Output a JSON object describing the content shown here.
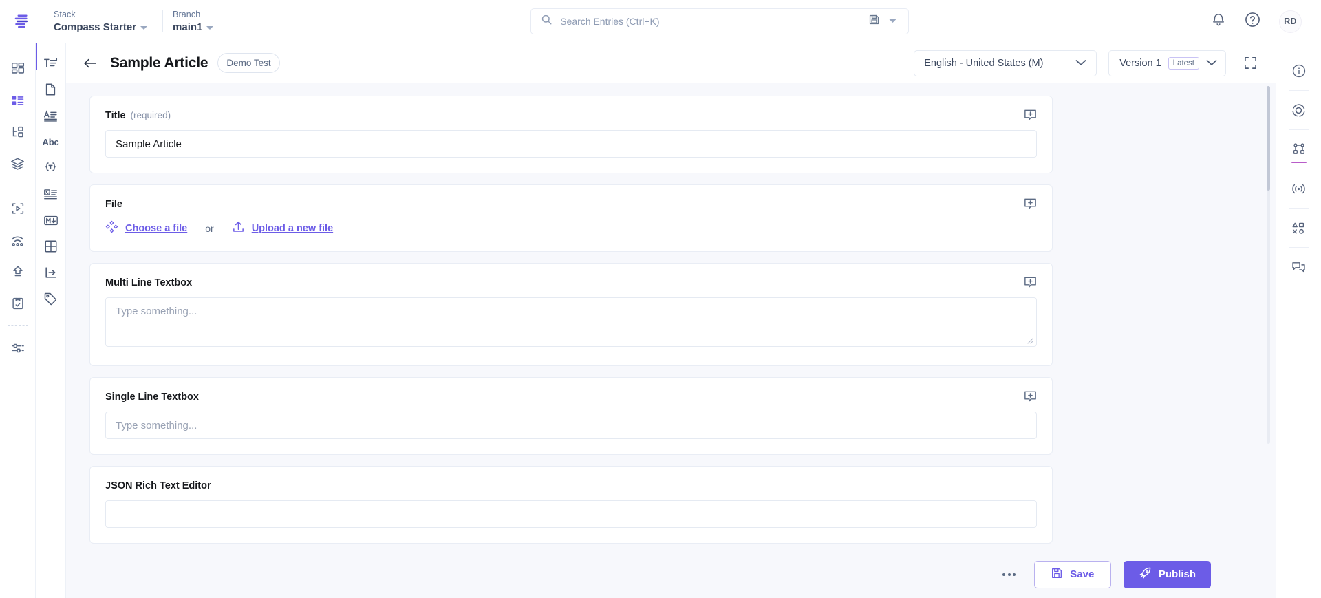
{
  "topbar": {
    "logo_icon": "contentstack-logo-icon",
    "stack": {
      "label": "Stack",
      "value": "Compass Starter"
    },
    "branch": {
      "label": "Branch",
      "value": "main1"
    },
    "search": {
      "placeholder": "Search Entries (Ctrl+K)",
      "value": "",
      "icon": "search-icon",
      "saved_icon": "floppy-disk-icon",
      "dropdown_icon": "caret-down-icon"
    },
    "notifications_icon": "bell-icon",
    "help_icon": "question-circle-icon",
    "avatar_initials": "RD"
  },
  "leftnav": {
    "items": [
      {
        "name": "dashboard",
        "icon": "dashboard-grid-icon",
        "active": false
      },
      {
        "name": "entries",
        "icon": "entries-list-icon",
        "active": true
      },
      {
        "name": "content-models",
        "icon": "sitemap-icon",
        "active": false
      },
      {
        "name": "assets",
        "icon": "layers-icon",
        "active": false
      },
      {
        "name": "live-preview",
        "icon": "media-play-frame-icon",
        "active": false
      },
      {
        "name": "releases",
        "icon": "broadcast-dots-icon",
        "active": false
      },
      {
        "name": "publish-queue",
        "icon": "upload-arrow-icon",
        "active": false
      },
      {
        "name": "tasks",
        "icon": "clipboard-check-icon",
        "active": false
      },
      {
        "name": "settings",
        "icon": "sliders-icon",
        "active": false
      }
    ]
  },
  "fieldrail": {
    "items": [
      {
        "name": "title-field",
        "icon": "text-title-icon"
      },
      {
        "name": "file-field",
        "icon": "file-page-icon"
      },
      {
        "name": "multiline-field",
        "icon": "paragraph-lines-icon"
      },
      {
        "name": "singleline-field",
        "icon": "abc-text-icon"
      },
      {
        "name": "json-rte-field",
        "icon": "curly-braces-t-icon"
      },
      {
        "name": "rich-text-field",
        "icon": "image-text-icon"
      },
      {
        "name": "markdown-field",
        "icon": "markdown-icon"
      },
      {
        "name": "table-field",
        "icon": "table-grid-icon"
      },
      {
        "name": "reference-field",
        "icon": "arrow-branch-icon"
      },
      {
        "name": "taxonomy-field",
        "icon": "tag-icon"
      }
    ]
  },
  "header": {
    "back_icon": "arrow-left-icon",
    "title": "Sample Article",
    "tag": "Demo Test",
    "locale": {
      "value": "English - United States (M)",
      "icon": "chevron-down-icon"
    },
    "version": {
      "label": "Version 1",
      "badge": "Latest",
      "icon": "chevron-down-icon"
    },
    "expand_icon": "fullscreen-icon"
  },
  "form": {
    "fields": [
      {
        "name": "title",
        "label": "Title",
        "required_text": "(required)",
        "type": "text",
        "value": "Sample Article",
        "placeholder": "",
        "comment_icon": "add-comment-icon"
      },
      {
        "name": "file",
        "label": "File",
        "required_text": "",
        "type": "file",
        "choose_label": "Choose a file",
        "choose_icon": "asset-diamond-icon",
        "or_text": "or",
        "upload_label": "Upload a new file",
        "upload_icon": "upload-icon",
        "comment_icon": "add-comment-icon"
      },
      {
        "name": "multi-line-textbox",
        "label": "Multi Line Textbox",
        "required_text": "",
        "type": "textarea",
        "value": "",
        "placeholder": "Type something...",
        "comment_icon": "add-comment-icon"
      },
      {
        "name": "single-line-textbox",
        "label": "Single Line Textbox",
        "required_text": "",
        "type": "text",
        "value": "",
        "placeholder": "Type something...",
        "comment_icon": "add-comment-icon"
      },
      {
        "name": "json-rich-text-editor",
        "label": "JSON Rich Text Editor",
        "required_text": "",
        "type": "rte",
        "value": "",
        "placeholder": "",
        "comment_icon": ""
      }
    ]
  },
  "rightrail": {
    "items": [
      {
        "name": "entry-details",
        "icon": "info-circle-icon",
        "active": false
      },
      {
        "name": "versions",
        "icon": "target-circle-icon",
        "active": false
      },
      {
        "name": "references",
        "icon": "node-graph-icon",
        "active": true
      },
      {
        "name": "publish-activity",
        "icon": "broadcast-icon",
        "active": false
      },
      {
        "name": "variants",
        "icon": "shapes-icon",
        "active": false
      },
      {
        "name": "discussions",
        "icon": "comments-icon",
        "active": false
      }
    ]
  },
  "actionbar": {
    "more_icon": "ellipsis-icon",
    "save_label": "Save",
    "save_icon": "floppy-save-icon",
    "publish_label": "Publish",
    "publish_icon": "rocket-icon"
  },
  "colors": {
    "accent": "#6c5ce7",
    "text": "#3b475e",
    "heading": "#16181c",
    "muted": "#8792a8",
    "canvas": "#f7f8fc",
    "border": "#e9edf5",
    "active_underline": "#b85cc9"
  }
}
